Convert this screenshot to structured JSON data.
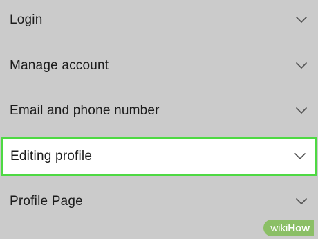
{
  "settings_list": {
    "items": [
      {
        "label": "Login",
        "icon": "chevron-down-icon",
        "highlighted": false
      },
      {
        "label": "Manage account",
        "icon": "chevron-down-icon",
        "highlighted": false
      },
      {
        "label": "Email and phone number",
        "icon": "chevron-down-icon",
        "highlighted": false
      },
      {
        "label": "Editing profile",
        "icon": "chevron-down-icon",
        "highlighted": true
      },
      {
        "label": "Profile Page",
        "icon": "chevron-down-icon",
        "highlighted": false
      }
    ]
  },
  "colors": {
    "background": "#cbcbcb",
    "highlight_border": "#4ed943",
    "highlight_fill": "#ffffff",
    "watermark_bg": "#8bbf66"
  },
  "watermark": {
    "part1": "wiki",
    "part2": "How"
  }
}
